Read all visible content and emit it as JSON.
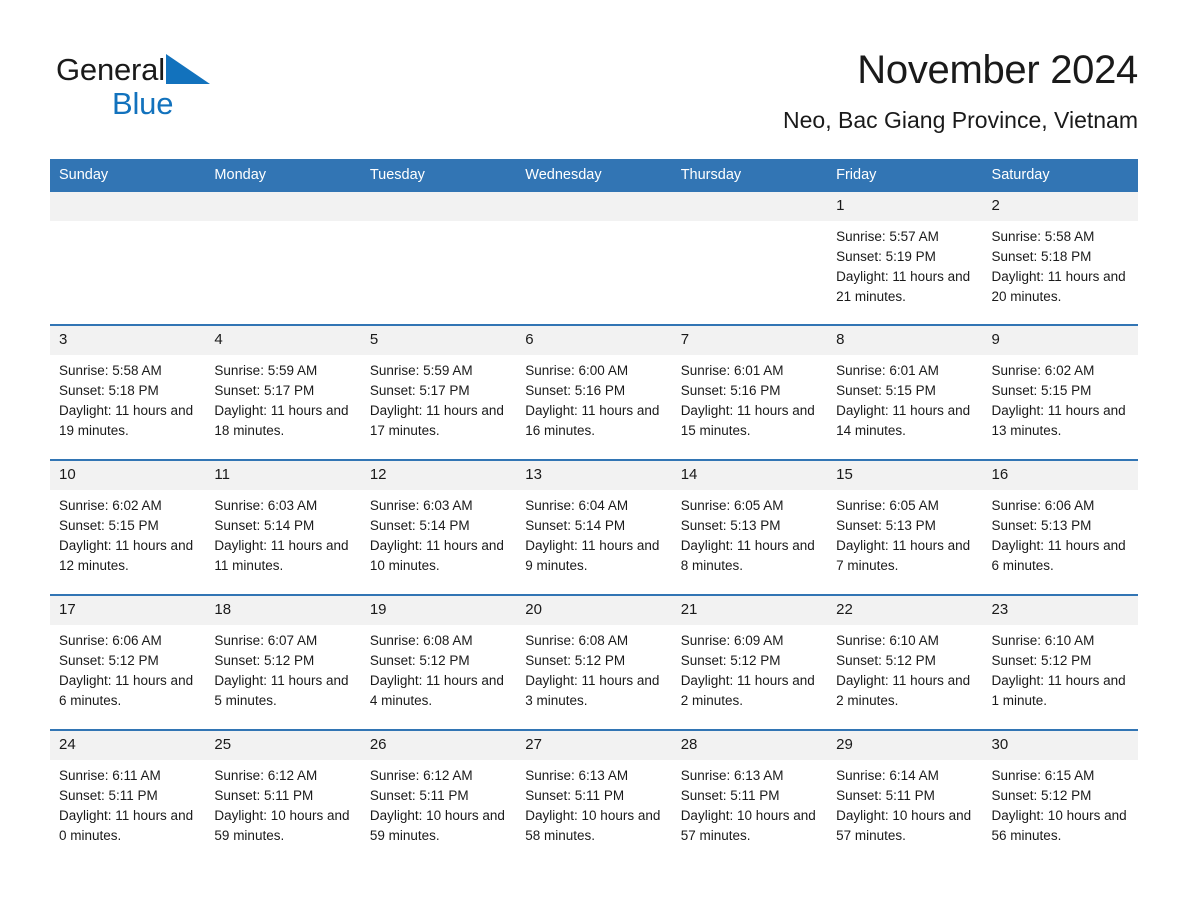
{
  "brand": {
    "word_general": "General",
    "word_blue": "Blue",
    "triangle_color": "#1272bd",
    "blue_text_color": "#1272bd"
  },
  "header": {
    "month_title": "November 2024",
    "location": "Neo, Bac Giang Province, Vietnam",
    "accent_color": "#3275b4",
    "daynum_band_color": "#f2f2f2"
  },
  "weekday_headers": [
    "Sunday",
    "Monday",
    "Tuesday",
    "Wednesday",
    "Thursday",
    "Friday",
    "Saturday"
  ],
  "labels": {
    "sunrise_prefix": "Sunrise:",
    "sunset_prefix": "Sunset:",
    "daylight_prefix": "Daylight:"
  },
  "weeks": [
    [
      {
        "day": "",
        "empty": true
      },
      {
        "day": "",
        "empty": true
      },
      {
        "day": "",
        "empty": true
      },
      {
        "day": "",
        "empty": true
      },
      {
        "day": "",
        "empty": true
      },
      {
        "day": "1",
        "sunrise": "Sunrise: 5:57 AM",
        "sunset": "Sunset: 5:19 PM",
        "daylight": "Daylight: 11 hours and 21 minutes."
      },
      {
        "day": "2",
        "sunrise": "Sunrise: 5:58 AM",
        "sunset": "Sunset: 5:18 PM",
        "daylight": "Daylight: 11 hours and 20 minutes."
      }
    ],
    [
      {
        "day": "3",
        "sunrise": "Sunrise: 5:58 AM",
        "sunset": "Sunset: 5:18 PM",
        "daylight": "Daylight: 11 hours and 19 minutes."
      },
      {
        "day": "4",
        "sunrise": "Sunrise: 5:59 AM",
        "sunset": "Sunset: 5:17 PM",
        "daylight": "Daylight: 11 hours and 18 minutes."
      },
      {
        "day": "5",
        "sunrise": "Sunrise: 5:59 AM",
        "sunset": "Sunset: 5:17 PM",
        "daylight": "Daylight: 11 hours and 17 minutes."
      },
      {
        "day": "6",
        "sunrise": "Sunrise: 6:00 AM",
        "sunset": "Sunset: 5:16 PM",
        "daylight": "Daylight: 11 hours and 16 minutes."
      },
      {
        "day": "7",
        "sunrise": "Sunrise: 6:01 AM",
        "sunset": "Sunset: 5:16 PM",
        "daylight": "Daylight: 11 hours and 15 minutes."
      },
      {
        "day": "8",
        "sunrise": "Sunrise: 6:01 AM",
        "sunset": "Sunset: 5:15 PM",
        "daylight": "Daylight: 11 hours and 14 minutes."
      },
      {
        "day": "9",
        "sunrise": "Sunrise: 6:02 AM",
        "sunset": "Sunset: 5:15 PM",
        "daylight": "Daylight: 11 hours and 13 minutes."
      }
    ],
    [
      {
        "day": "10",
        "sunrise": "Sunrise: 6:02 AM",
        "sunset": "Sunset: 5:15 PM",
        "daylight": "Daylight: 11 hours and 12 minutes."
      },
      {
        "day": "11",
        "sunrise": "Sunrise: 6:03 AM",
        "sunset": "Sunset: 5:14 PM",
        "daylight": "Daylight: 11 hours and 11 minutes."
      },
      {
        "day": "12",
        "sunrise": "Sunrise: 6:03 AM",
        "sunset": "Sunset: 5:14 PM",
        "daylight": "Daylight: 11 hours and 10 minutes."
      },
      {
        "day": "13",
        "sunrise": "Sunrise: 6:04 AM",
        "sunset": "Sunset: 5:14 PM",
        "daylight": "Daylight: 11 hours and 9 minutes."
      },
      {
        "day": "14",
        "sunrise": "Sunrise: 6:05 AM",
        "sunset": "Sunset: 5:13 PM",
        "daylight": "Daylight: 11 hours and 8 minutes."
      },
      {
        "day": "15",
        "sunrise": "Sunrise: 6:05 AM",
        "sunset": "Sunset: 5:13 PM",
        "daylight": "Daylight: 11 hours and 7 minutes."
      },
      {
        "day": "16",
        "sunrise": "Sunrise: 6:06 AM",
        "sunset": "Sunset: 5:13 PM",
        "daylight": "Daylight: 11 hours and 6 minutes."
      }
    ],
    [
      {
        "day": "17",
        "sunrise": "Sunrise: 6:06 AM",
        "sunset": "Sunset: 5:12 PM",
        "daylight": "Daylight: 11 hours and 6 minutes."
      },
      {
        "day": "18",
        "sunrise": "Sunrise: 6:07 AM",
        "sunset": "Sunset: 5:12 PM",
        "daylight": "Daylight: 11 hours and 5 minutes."
      },
      {
        "day": "19",
        "sunrise": "Sunrise: 6:08 AM",
        "sunset": "Sunset: 5:12 PM",
        "daylight": "Daylight: 11 hours and 4 minutes."
      },
      {
        "day": "20",
        "sunrise": "Sunrise: 6:08 AM",
        "sunset": "Sunset: 5:12 PM",
        "daylight": "Daylight: 11 hours and 3 minutes."
      },
      {
        "day": "21",
        "sunrise": "Sunrise: 6:09 AM",
        "sunset": "Sunset: 5:12 PM",
        "daylight": "Daylight: 11 hours and 2 minutes."
      },
      {
        "day": "22",
        "sunrise": "Sunrise: 6:10 AM",
        "sunset": "Sunset: 5:12 PM",
        "daylight": "Daylight: 11 hours and 2 minutes."
      },
      {
        "day": "23",
        "sunrise": "Sunrise: 6:10 AM",
        "sunset": "Sunset: 5:12 PM",
        "daylight": "Daylight: 11 hours and 1 minute."
      }
    ],
    [
      {
        "day": "24",
        "sunrise": "Sunrise: 6:11 AM",
        "sunset": "Sunset: 5:11 PM",
        "daylight": "Daylight: 11 hours and 0 minutes."
      },
      {
        "day": "25",
        "sunrise": "Sunrise: 6:12 AM",
        "sunset": "Sunset: 5:11 PM",
        "daylight": "Daylight: 10 hours and 59 minutes."
      },
      {
        "day": "26",
        "sunrise": "Sunrise: 6:12 AM",
        "sunset": "Sunset: 5:11 PM",
        "daylight": "Daylight: 10 hours and 59 minutes."
      },
      {
        "day": "27",
        "sunrise": "Sunrise: 6:13 AM",
        "sunset": "Sunset: 5:11 PM",
        "daylight": "Daylight: 10 hours and 58 minutes."
      },
      {
        "day": "28",
        "sunrise": "Sunrise: 6:13 AM",
        "sunset": "Sunset: 5:11 PM",
        "daylight": "Daylight: 10 hours and 57 minutes."
      },
      {
        "day": "29",
        "sunrise": "Sunrise: 6:14 AM",
        "sunset": "Sunset: 5:11 PM",
        "daylight": "Daylight: 10 hours and 57 minutes."
      },
      {
        "day": "30",
        "sunrise": "Sunrise: 6:15 AM",
        "sunset": "Sunset: 5:12 PM",
        "daylight": "Daylight: 10 hours and 56 minutes."
      }
    ]
  ]
}
